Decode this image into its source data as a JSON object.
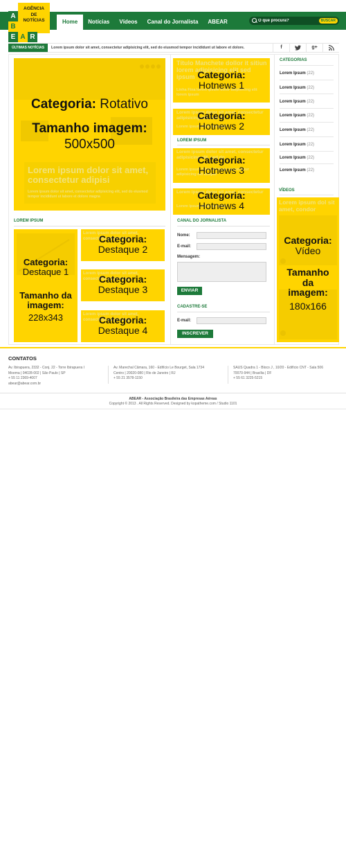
{
  "brand": {
    "logo_text": [
      "AGÊNCIA",
      "DE",
      "NOTÍCIAS"
    ],
    "logo_letters": [
      "A",
      "B",
      "E",
      "A",
      "R"
    ],
    "colors": {
      "green": "#1d7a3a",
      "yellow": "#ffd400"
    }
  },
  "nav": {
    "items": [
      "Home",
      "Notícias",
      "Vídeos",
      "Canal do Jornalista",
      "ABEAR"
    ],
    "active": "Home"
  },
  "search": {
    "placeholder": "O que procura?",
    "button": "BUSCAR"
  },
  "ticker": {
    "label": "ÚLTIMAS NOTÍCIAS",
    "text": "Lorem ipsum dolor sit amet, consectetur adipisicing elit, sed do eiusmod tempor incididunt ut labore et dolore.",
    "social": [
      "f",
      "t",
      "g+",
      "rss"
    ]
  },
  "rotativo": {
    "category_label": "Categoria:",
    "category": "Rotativo",
    "size_label": "Tamanho imagem:",
    "size": "500x500",
    "faint_title": "Lorem ipsum dolor sit amet, consectetur adipisi",
    "faint_text": "Lorem ipsum dolor sit amet, consectetur adipisicing elit, sed do eiusmod tempor incididunt ut labore et dolore magna"
  },
  "hotnews": [
    {
      "label": "Categoria:",
      "name": "Hotnews 1",
      "faint": "Título Manchete dollor it sitiun lorem adipisicing elit sed ipsum",
      "faint_small": "Linha Fina lorem ipsum dolor adipisicing elit lorem ipsum"
    },
    {
      "label": "Categoria:",
      "name": "Hotnews 2",
      "faint": "Lorem ipsum dolor sit amet, consectetur adipisicing elit, sed do",
      "faint_small": "Lorem ipsum dolor sit amet"
    },
    {
      "label": "Categoria:",
      "name": "Hotnews 3",
      "faint": "Lorem ipsum dolor sit amet, consectetur adipisicing elit, sed do",
      "faint_small": "Lorem ipsum dolor sit amet consectetur adipisicing elit tempor"
    },
    {
      "label": "Categoria:",
      "name": "Hotnews 4",
      "faint": "Lorem ipsum dolor sit amet, consectetur",
      "faint_small": "Lorem ipsum dolor sit amet"
    }
  ],
  "hotnews_section": "LOREM IPSUM",
  "destaques_section": "LOREM IPSUM",
  "destaque1": {
    "label": "Categoria:",
    "name": "Destaque 1",
    "size_label": "Tamanho da imagem:",
    "size": "228x343"
  },
  "destaques": [
    {
      "label": "Categoria:",
      "name": "Destaque 2",
      "faint": "Lorem ipsum dolor sit amet, consectetur adipisicing"
    },
    {
      "label": "Categoria:",
      "name": "Destaque 3",
      "faint": "Lorem ipsum dolor sit amet, consectetur adipisicing"
    },
    {
      "label": "Categoria:",
      "name": "Destaque 4",
      "faint": "Lorem ipsum dolor sit amet, consectetur adipisicing"
    }
  ],
  "canal": {
    "title": "CANAL DO JORNALISTA",
    "nome": "Nome:",
    "email": "E-mail:",
    "mensagem": "Mensagem:",
    "enviar": "ENVIAR"
  },
  "cadastre": {
    "title": "CADASTRE-SE",
    "email": "E-mail:",
    "inscrever": "INSCREVER"
  },
  "categorias": {
    "title": "CATEGORIAS",
    "items": [
      {
        "name": "Lorem Ipsum",
        "count": "(22)"
      },
      {
        "name": "Lorem Ipsum",
        "count": "(22)"
      },
      {
        "name": "Lorem Ipsum",
        "count": "(22)"
      },
      {
        "name": "Lorem Ipsum",
        "count": "(22)"
      },
      {
        "name": "Lorem Ipsum",
        "count": "(22)"
      },
      {
        "name": "Lorem Ipsum",
        "count": "(22)"
      },
      {
        "name": "Lorem Ipsum",
        "count": "(22)"
      },
      {
        "name": "Lorem Ipsum",
        "count": "(22)"
      }
    ]
  },
  "videos": {
    "title": "VÍDEOS",
    "label": "Categoria:",
    "name": "Vídeo",
    "size_label": "Tamanho da imagem:",
    "size": "180x166",
    "faint": "Lorem ipsum dol sit amet, condor"
  },
  "footer": {
    "title": "CONTATOS",
    "addresses": [
      [
        "Av. Ibirapuera, 2332 - Conj. 22 - Torre Ibirapuera I",
        "Moema | 04028-002 | São Paulo | SP",
        "+ 55 11 2369-4007",
        "abear@abear.com.br"
      ],
      [
        "Av. Marechal Câmara, 160 - Edifício Le Bourget, Sala 1734",
        "Centro | 20020-080 | Rio de Janeiro | RJ",
        "+ 55 21 3578-1150"
      ],
      [
        "SAUS Quadra 1 - Bloco J , 10/20 - Edifício CNT - Sala 506",
        "70070-944 | Brasília | DF",
        "+ 55 61 3225-5215"
      ]
    ],
    "org": "ABEAR - Associação Brasileira das Empresas Aéreas",
    "copyright": "Copyright © 2013 . All Rights Reserved. Designed by kopatheme.com / Studio 1101"
  }
}
